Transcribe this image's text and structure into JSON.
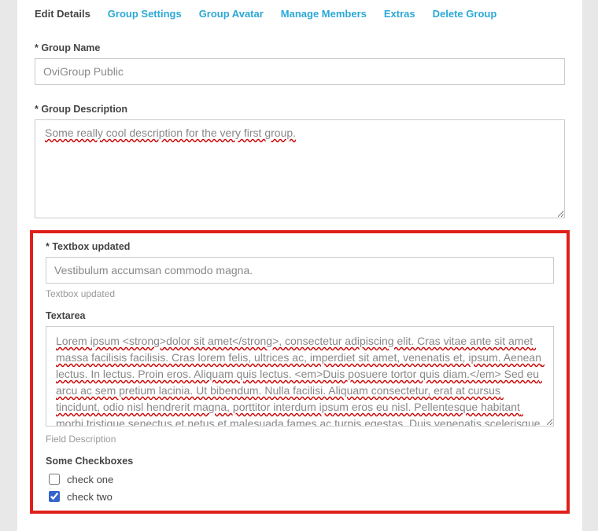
{
  "tabs": {
    "editDetails": "Edit Details",
    "groupSettings": "Group Settings",
    "groupAvatar": "Group Avatar",
    "manageMembers": "Manage Members",
    "extras": "Extras",
    "deleteGroup": "Delete Group"
  },
  "groupName": {
    "label": "* Group Name",
    "value": "OviGroup Public"
  },
  "groupDesc": {
    "label": "* Group Description",
    "value": "Some really cool description for the very first group."
  },
  "textboxUpdated": {
    "label": "* Textbox updated",
    "value": "Vestibulum accumsan commodo magna.",
    "hint": "Textbox updated"
  },
  "textarea": {
    "label": "Textarea",
    "value": "Lorem ipsum <strong>dolor sit amet</strong>, consectetur adipiscing elit. Cras vitae ante sit amet massa facilisis facilisis. Cras lorem felis, ultrices ac, imperdiet sit amet, venenatis et, ipsum. Aenean lectus. In lectus. Proin eros. Aliquam quis lectus. <em>Duis posuere tortor quis diam.</em> Sed eu arcu ac sem pretium lacinia. Ut bibendum. Nulla facilisi. Aliquam consectetur, erat at cursus tincidunt, odio nisl hendrerit magna, porttitor interdum ipsum eros eu nisl. Pellentesque habitant morbi tristique senectus et netus et malesuada fames ac turpis egestas. Duis venenatis scelerisque dolor. Nulla",
    "hint": "Field Description"
  },
  "checkboxes": {
    "label": "Some Checkboxes",
    "items": [
      {
        "label": "check one",
        "checked": false
      },
      {
        "label": "check two",
        "checked": true
      }
    ]
  }
}
